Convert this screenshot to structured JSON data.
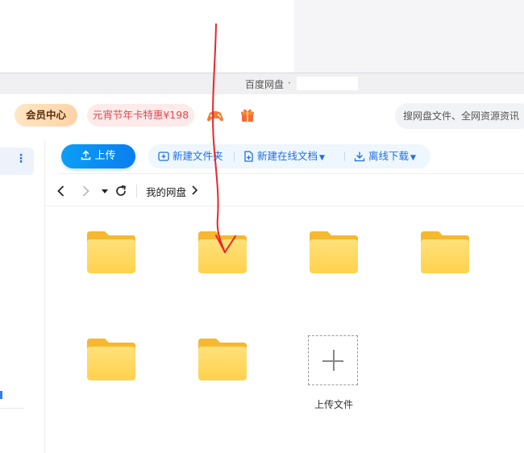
{
  "window": {
    "title": "百度网盘",
    "title_separator": "·"
  },
  "header": {
    "vip_label": "会员中心",
    "promo_label": "元宵节年卡特惠¥198",
    "game_icon": "gamepad-icon",
    "gift_icon": "gift-icon",
    "search_placeholder": "搜网盘文件、全网资源资讯"
  },
  "sidebar": {
    "more_icon": "more-vertical-icon",
    "more_glyph": "⋮"
  },
  "toolbar": {
    "upload_label": "上传",
    "new_folder_label": "新建文件夹",
    "new_online_doc_label": "新建在线文档",
    "offline_download_label": "离线下载"
  },
  "navbar": {
    "breadcrumb": "我的网盘"
  },
  "content": {
    "folder_count": 6,
    "upload_tile_label": "上传文件"
  },
  "colors": {
    "accent_blue": "#0b7ef0",
    "folder_yellow": "#ffd24d",
    "promo_red": "#e5484d",
    "annotation_red": "#e8262b"
  }
}
